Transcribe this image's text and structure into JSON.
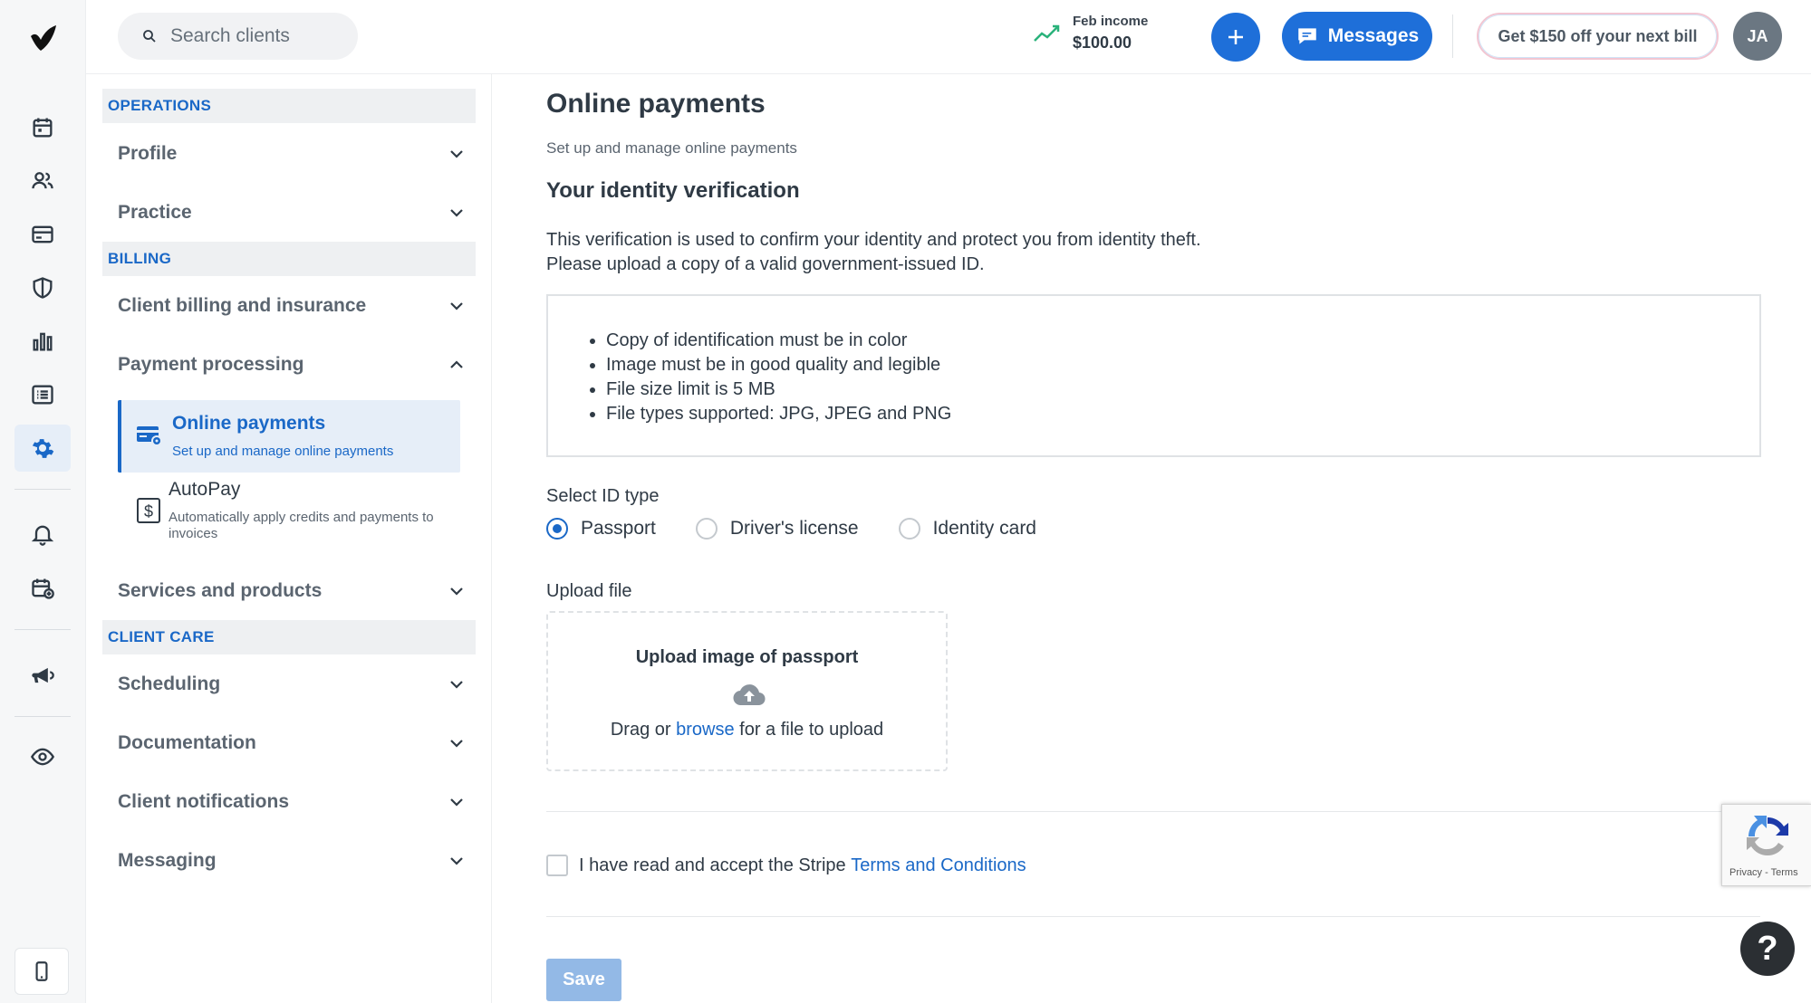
{
  "topbar": {
    "search_placeholder": "Search clients",
    "income_label": "Feb income",
    "income_value": "$100.00",
    "messages_label": "Messages",
    "promo_label": "Get $150 off your next bill",
    "avatar_initials": "JA",
    "accent_color": "#1e6fd9"
  },
  "rail": {
    "icons": [
      "logo-icon",
      "calendar-icon",
      "clients-icon",
      "billing-card-icon",
      "shield-icon",
      "bar-chart-icon",
      "list-icon",
      "settings-gear-icon",
      "bell-icon",
      "calendar-add-icon",
      "megaphone-icon",
      "eye-icon",
      "mobile-phone-icon"
    ]
  },
  "sidebar": {
    "sections": [
      {
        "header": "OPERATIONS",
        "items": [
          "Profile",
          "Practice"
        ]
      },
      {
        "header": "BILLING",
        "items": [
          "Client billing and insurance",
          "Payment processing",
          "Services and products"
        ]
      },
      {
        "header": "CLIENT CARE",
        "items": [
          "Scheduling",
          "Documentation",
          "Client notifications",
          "Messaging"
        ]
      }
    ],
    "subitems": [
      {
        "title": "Online payments",
        "desc": "Set up and manage online payments"
      },
      {
        "title": "AutoPay",
        "desc": "Automatically apply credits and payments to invoices"
      }
    ]
  },
  "main": {
    "title": "Online payments",
    "subtitle": "Set up and manage online payments",
    "section_title": "Your identity verification",
    "intro_line1": "This verification is used to confirm your identity and protect you from identity theft.",
    "intro_line2": "Please upload a copy of a valid government-issued ID.",
    "requirements": [
      "Copy of identification must be in color",
      "Image must be in good quality and legible",
      "File size limit is 5 MB",
      "File types supported: JPG, JPEG and PNG"
    ],
    "id_type_label": "Select ID type",
    "id_types": [
      "Passport",
      "Driver's license",
      "Identity card"
    ],
    "selected_id_type": "Passport",
    "upload_label": "Upload file",
    "upload_title": "Upload image of passport",
    "upload_drag": "Drag or",
    "upload_browse": "browse",
    "upload_rest": "for a file to upload",
    "terms_text": "I have read and accept the Stripe",
    "terms_link": "Terms and Conditions",
    "save_label": "Save"
  },
  "recaptcha": {
    "text": "Privacy - Terms"
  },
  "help": {
    "label": "?"
  }
}
